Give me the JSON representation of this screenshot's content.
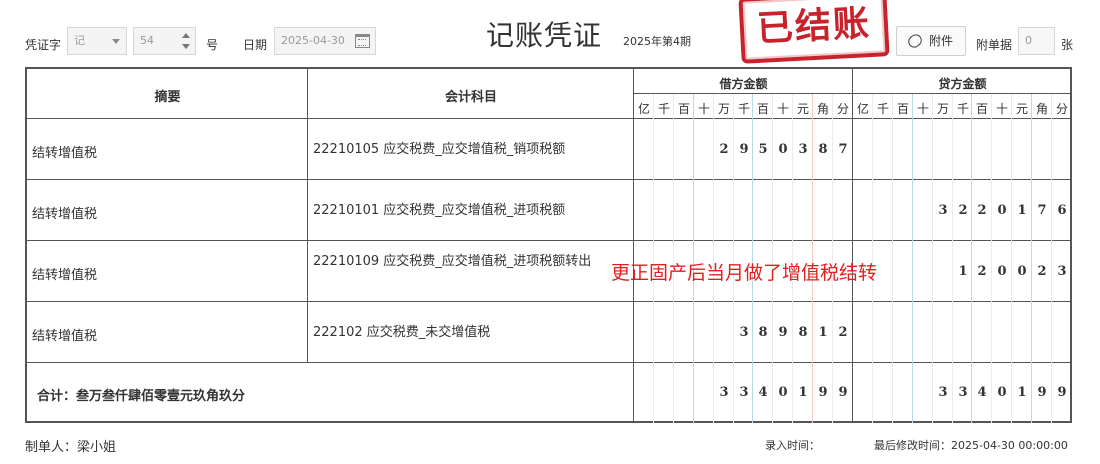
{
  "header": {
    "voucher_word_label": "凭证字",
    "voucher_word_value": "记",
    "voucher_number_value": "54",
    "number_suffix": "号",
    "date_label": "日期",
    "date_value": "2025-04-30",
    "title": "记账凭证",
    "period": "2025年第4期",
    "stamp": "已结账",
    "attach_button": "附件",
    "attach_count_label": "附单据",
    "attach_count_value": "0",
    "attach_count_unit": "张"
  },
  "table": {
    "col_summary": "摘要",
    "col_account": "会计科目",
    "col_debit": "借方金额",
    "col_credit": "贷方金额",
    "units": [
      "亿",
      "千",
      "百",
      "十",
      "万",
      "千",
      "百",
      "十",
      "元",
      "角",
      "分"
    ],
    "rows": [
      {
        "summary": "结转增值税",
        "account": "22210105 应交税费_应交增值税_销项税额",
        "debit": "2950387",
        "credit": ""
      },
      {
        "summary": "结转增值税",
        "account": "22210101 应交税费_应交增值税_进项税额",
        "debit": "",
        "credit": "3220176"
      },
      {
        "summary": "结转增值税",
        "account": "22210109 应交税费_应交增值税_进项税额转出",
        "debit": "",
        "credit": "120023"
      },
      {
        "summary": "结转增值税",
        "account": "222102 应交税费_未交增值税",
        "debit": "389812",
        "credit": ""
      }
    ],
    "total_label": "合计：叁万叁仟肆佰零壹元玖角玖分",
    "total_debit": "3340199",
    "total_credit": "3340199"
  },
  "annotation": "更正固产后当月做了增值税结转",
  "footer": {
    "maker": "制单人：梁小姐",
    "entry_time_label": "录入时间：",
    "last_modified": "最后修改时间：2025-04-30 00:00:00"
  }
}
